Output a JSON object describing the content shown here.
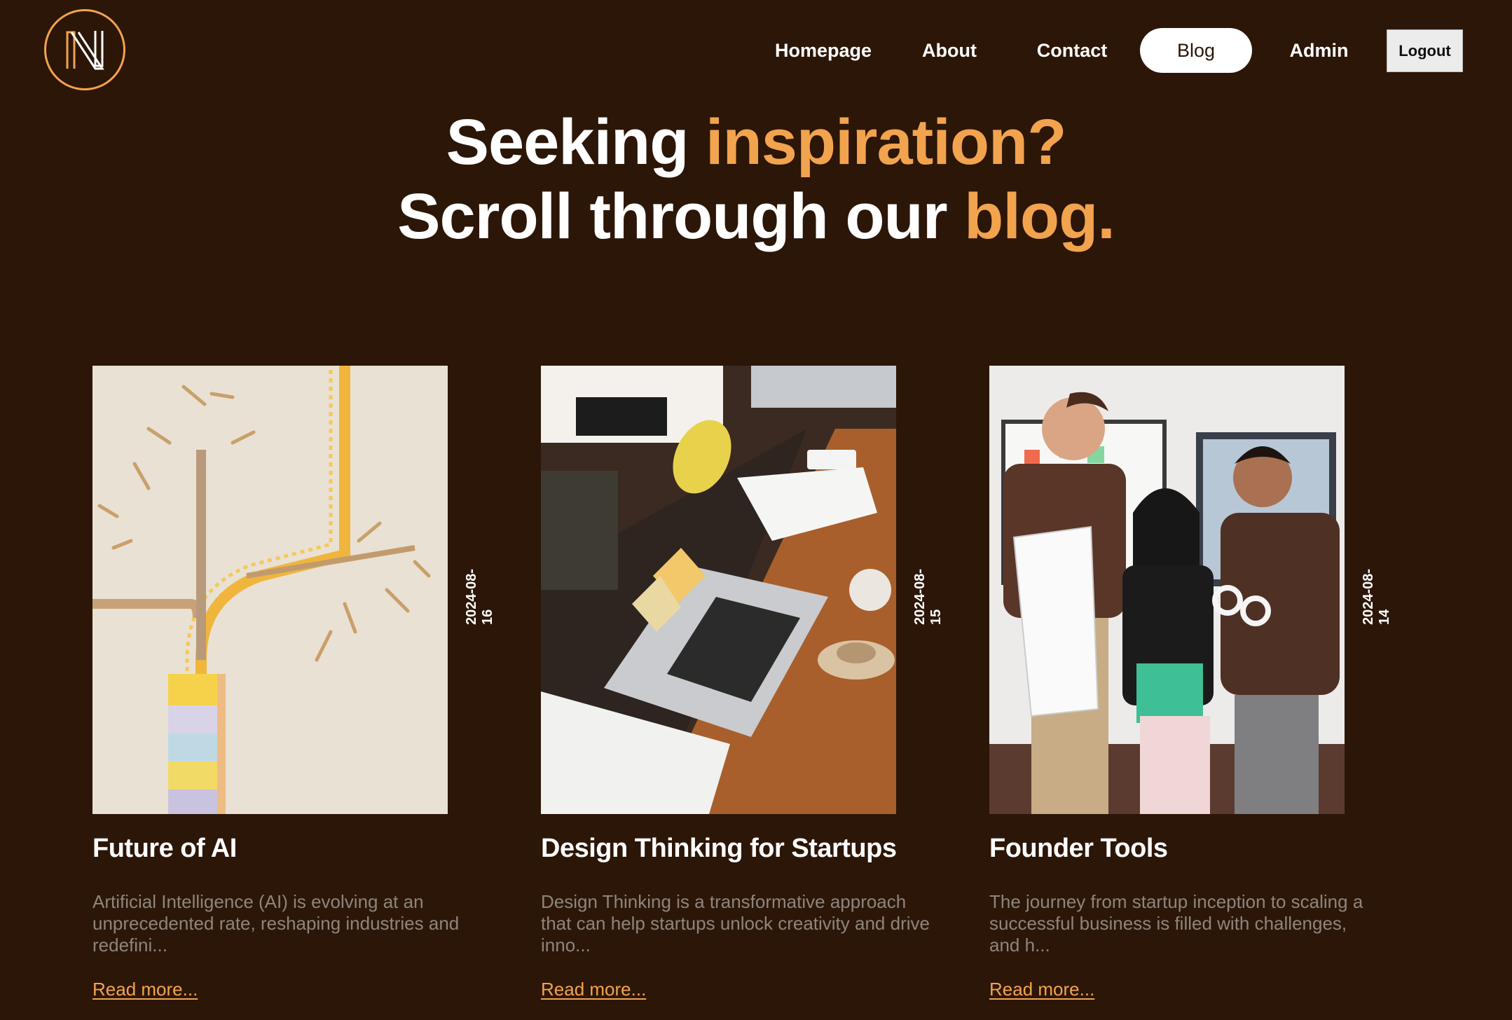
{
  "brand": {
    "logo_icon": "n-monogram-logo",
    "accent_color": "#f2a34e",
    "background_color": "#2c1608"
  },
  "nav": {
    "items": [
      {
        "label": "Homepage"
      },
      {
        "label": "About"
      },
      {
        "label": "Contact"
      },
      {
        "label": "Blog",
        "active": true
      },
      {
        "label": "Admin"
      }
    ],
    "logout_label": "Logout"
  },
  "hero": {
    "line1_plain": "Seeking ",
    "line1_accent": "inspiration?",
    "line2_plain": "Scroll through our ",
    "line2_accent": "blog."
  },
  "posts": [
    {
      "title": "Future of AI",
      "date": "2024-08-16",
      "excerpt": "Artificial Intelligence (AI) is evolving at an unprecedented rate, reshaping industries and redefini...",
      "read_more": "Read more...",
      "image_icon": "railway-tracks-photo"
    },
    {
      "title": "Design Thinking for Startups",
      "date": "2024-08-15",
      "excerpt": "Design Thinking is a transformative approach that can help startups unlock creativity and drive inno...",
      "read_more": "Read more...",
      "image_icon": "laptop-desk-photo"
    },
    {
      "title": "Founder Tools",
      "date": "2024-08-14",
      "excerpt": "The journey from startup inception to scaling a successful business is filled with challenges, and h...",
      "read_more": "Read more...",
      "image_icon": "team-photo"
    }
  ]
}
